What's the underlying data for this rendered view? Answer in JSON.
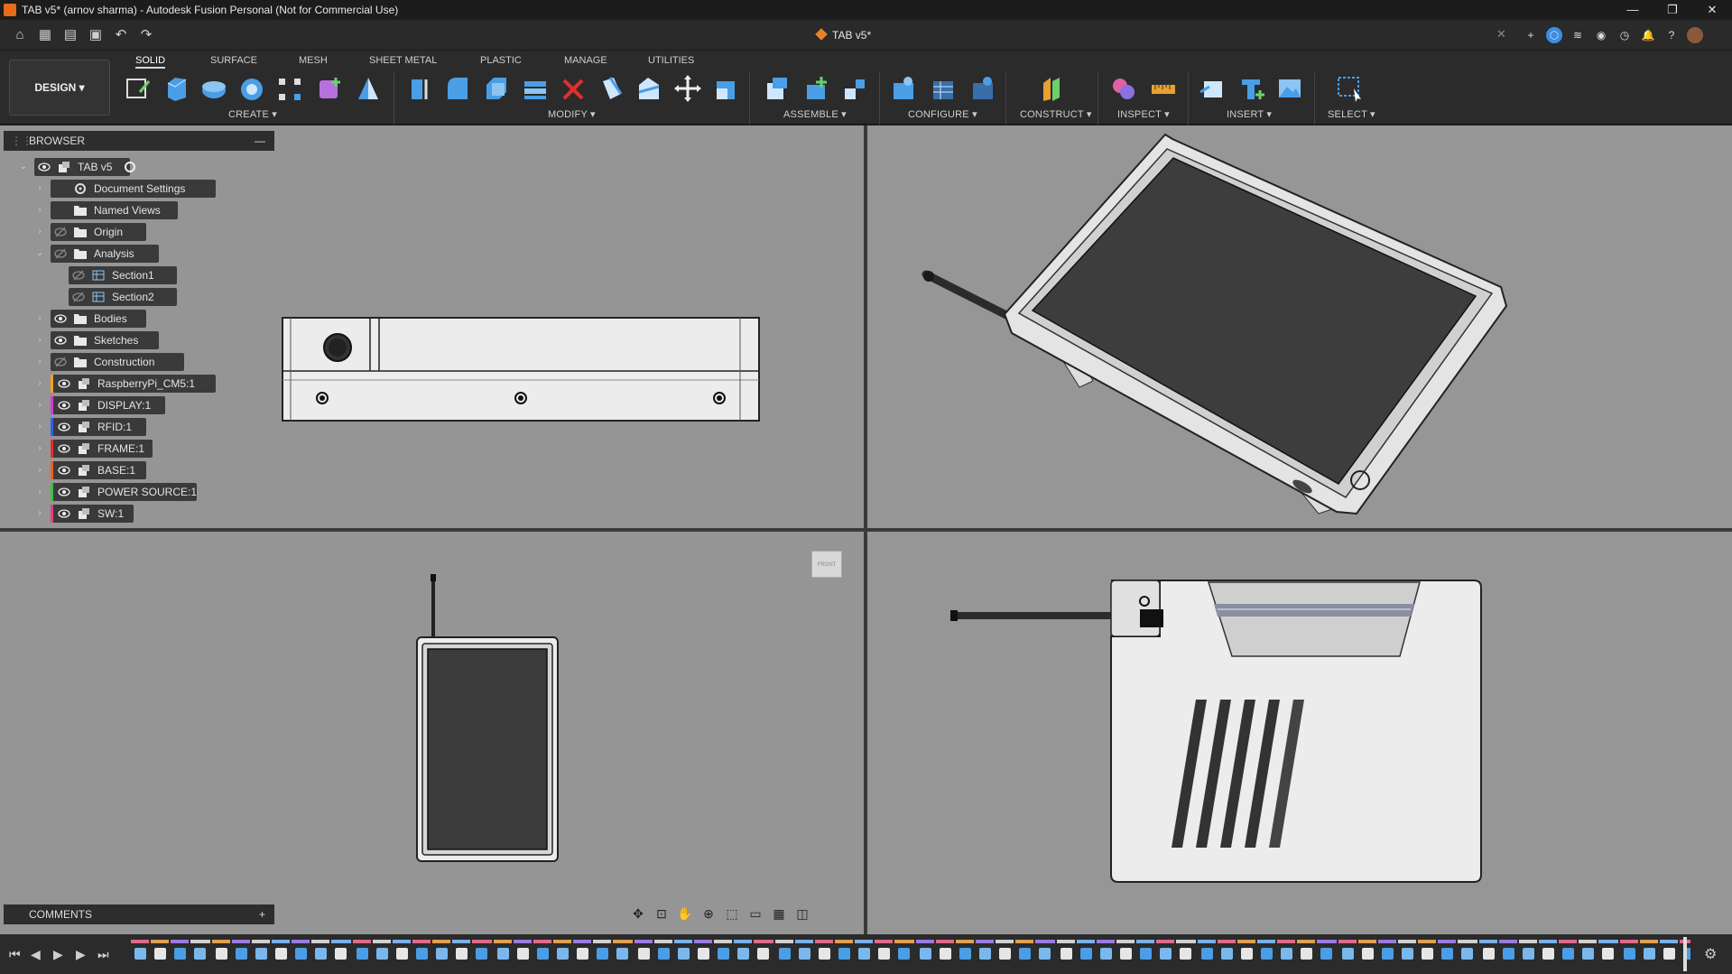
{
  "window": {
    "title": "TAB v5* (arnov sharma) - Autodesk Fusion Personal (Not for Commercial Use)",
    "controls": [
      "—",
      "❐",
      "✕"
    ]
  },
  "quick_access": {
    "icons": [
      "home-icon",
      "grid-icon",
      "file-icon",
      "save-icon",
      "undo-icon",
      "redo-icon"
    ]
  },
  "doc_tab": {
    "label": "TAB v5*",
    "close": "✕"
  },
  "right_icons": [
    "plus-icon",
    "extensions-icon",
    "job-status-icon",
    "online-icon",
    "clock-icon",
    "bell-icon",
    "help-icon",
    "avatar"
  ],
  "ribbon": {
    "workspace": "DESIGN",
    "tabs": [
      "SOLID",
      "SURFACE",
      "MESH",
      "SHEET METAL",
      "PLASTIC",
      "MANAGE",
      "UTILITIES"
    ],
    "active_tab": "SOLID",
    "groups": [
      {
        "label": "CREATE"
      },
      {
        "label": "MODIFY"
      },
      {
        "label": "ASSEMBLE"
      },
      {
        "label": "CONFIGURE"
      },
      {
        "label": "CONSTRUCT"
      },
      {
        "label": "INSPECT"
      },
      {
        "label": "INSERT"
      },
      {
        "label": "SELECT"
      }
    ]
  },
  "browser": {
    "title": "BROWSER",
    "items": [
      {
        "label": "TAB v5",
        "level": 0,
        "expanded": true,
        "icon": "component-icon"
      },
      {
        "label": "Document Settings",
        "level": 1,
        "icon": "gear-icon"
      },
      {
        "label": "Named Views",
        "level": 1,
        "icon": "folder-icon"
      },
      {
        "label": "Origin",
        "level": 1,
        "icon": "folder-icon",
        "hidden": true
      },
      {
        "label": "Analysis",
        "level": 1,
        "icon": "folder-icon",
        "expanded": true,
        "hidden": true
      },
      {
        "label": "Section1",
        "level": 2,
        "icon": "section-icon",
        "hidden": true
      },
      {
        "label": "Section2",
        "level": 2,
        "icon": "section-icon",
        "hidden": true
      },
      {
        "label": "Bodies",
        "level": 1,
        "icon": "folder-icon"
      },
      {
        "label": "Sketches",
        "level": 1,
        "icon": "folder-icon"
      },
      {
        "label": "Construction",
        "level": 1,
        "icon": "folder-icon",
        "hidden": true
      },
      {
        "label": "RaspberryPi_CM5:1",
        "level": 1,
        "icon": "component-icon",
        "color": "#f0a020"
      },
      {
        "label": "DISPLAY:1",
        "level": 1,
        "icon": "component-icon",
        "color": "#d040d0"
      },
      {
        "label": "RFID:1",
        "level": 1,
        "icon": "component-icon",
        "color": "#3060f0"
      },
      {
        "label": "FRAME:1",
        "level": 1,
        "icon": "component-icon",
        "color": "#e03030"
      },
      {
        "label": "BASE:1",
        "level": 1,
        "icon": "component-icon",
        "color": "#f06020"
      },
      {
        "label": "POWER SOURCE:1",
        "level": 1,
        "icon": "component-icon",
        "color": "#40c040"
      },
      {
        "label": "SW:1",
        "level": 1,
        "icon": "component-icon",
        "color": "#e04080"
      }
    ]
  },
  "viewcube": {
    "label": "FRONT"
  },
  "comments": {
    "title": "COMMENTS",
    "add": "+"
  },
  "navbar": {
    "icons": [
      "orbit-icon",
      "look-at-icon",
      "pan-icon",
      "zoom-icon",
      "fit-icon",
      "display-settings-icon",
      "grid-settings-icon",
      "viewports-icon"
    ]
  },
  "timeline": {
    "controls": [
      "⏮",
      "◀",
      "▶",
      "▶",
      "⏭"
    ]
  }
}
